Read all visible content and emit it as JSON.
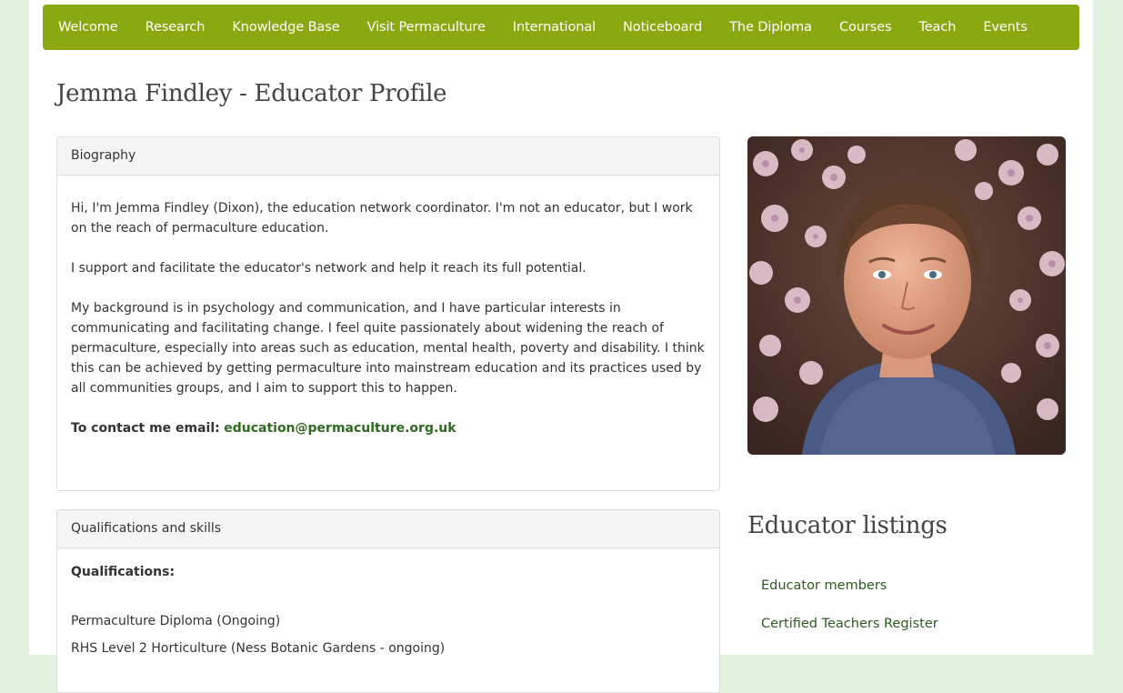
{
  "nav": {
    "items": [
      {
        "label": "Welcome"
      },
      {
        "label": "Research"
      },
      {
        "label": "Knowledge Base"
      },
      {
        "label": "Visit Permaculture"
      },
      {
        "label": "International"
      },
      {
        "label": "Noticeboard"
      },
      {
        "label": "The Diploma"
      },
      {
        "label": "Courses"
      },
      {
        "label": "Teach"
      },
      {
        "label": "Events"
      }
    ]
  },
  "page": {
    "title": "Jemma Findley - Educator Profile"
  },
  "biography": {
    "heading": "Biography",
    "paragraphs": [
      "Hi, I'm Jemma Findley (Dixon), the education network coordinator.  I'm not an educator, but I work on the reach of permaculture education.",
      "I support and facilitate the educator's network and help it reach its full potential.",
      "My background is in psychology and communication, and I have particular interests in communicating and facilitating change. I feel quite passionately about widening the reach of permaculture, especially into areas such as education, mental health, poverty and disability. I think this can be achieved by getting permaculture into mainstream education and its practices used by all communities groups, and I aim to support this to happen."
    ],
    "contact_label": "To contact me email:",
    "contact_email": "education@permaculture.org.uk"
  },
  "qualifications": {
    "heading": "Qualifications and skills",
    "label": "Qualifications:",
    "items": [
      "Permaculture Diploma (Ongoing)",
      "RHS Level 2 Horticulture (Ness Botanic Gardens - ongoing)"
    ]
  },
  "sidebar": {
    "title": "Educator listings",
    "links": [
      {
        "label": "Educator members"
      },
      {
        "label": "Certified Teachers Register"
      }
    ]
  },
  "colors": {
    "nav_bg": "#8aa80f",
    "page_bg": "#e3f2de",
    "link": "#2d6a1f"
  }
}
